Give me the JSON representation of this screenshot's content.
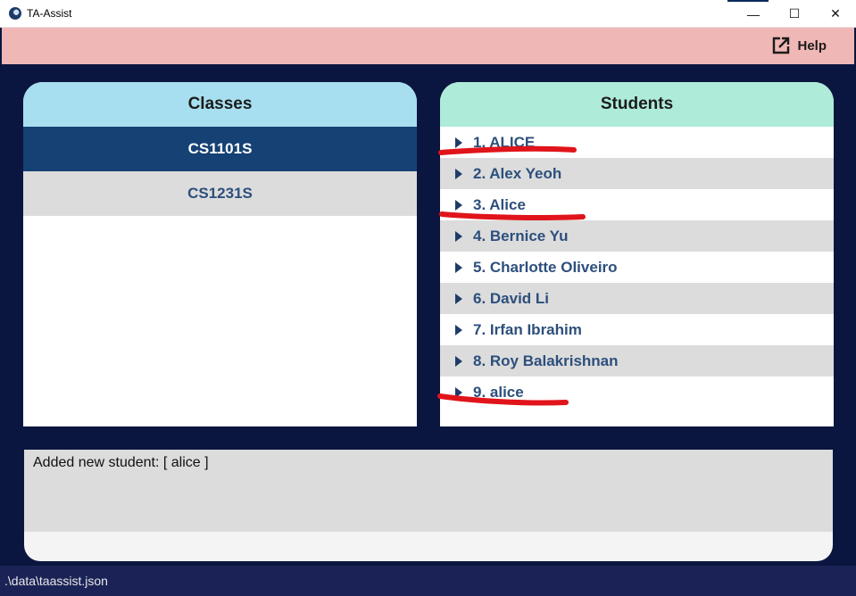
{
  "window": {
    "title": "TA-Assist",
    "minimize": "—",
    "maximize": "☐",
    "close": "✕"
  },
  "menu": {
    "help_label": "Help"
  },
  "classes": {
    "header": "Classes",
    "items": [
      {
        "label": "CS1101S",
        "selected": true
      },
      {
        "label": "CS1231S",
        "selected": false
      }
    ]
  },
  "students": {
    "header": "Students",
    "items": [
      {
        "label": "1. ALICE"
      },
      {
        "label": "2. Alex Yeoh"
      },
      {
        "label": "3. Alice"
      },
      {
        "label": "4. Bernice Yu"
      },
      {
        "label": "5. Charlotte Oliveiro"
      },
      {
        "label": "6. David Li"
      },
      {
        "label": "7. Irfan Ibrahim"
      },
      {
        "label": "8. Roy Balakrishnan"
      },
      {
        "label": "9. alice"
      }
    ]
  },
  "result": {
    "message": "Added new student: [ alice ]"
  },
  "status": {
    "path": ".\\data\\taassist.json"
  },
  "colors": {
    "background": "#0b1640",
    "menubar": "#efb7b5",
    "classes_header": "#a8dff0",
    "students_header": "#aeebd9",
    "selected_class": "#154174",
    "annotation": "#e0141a"
  }
}
